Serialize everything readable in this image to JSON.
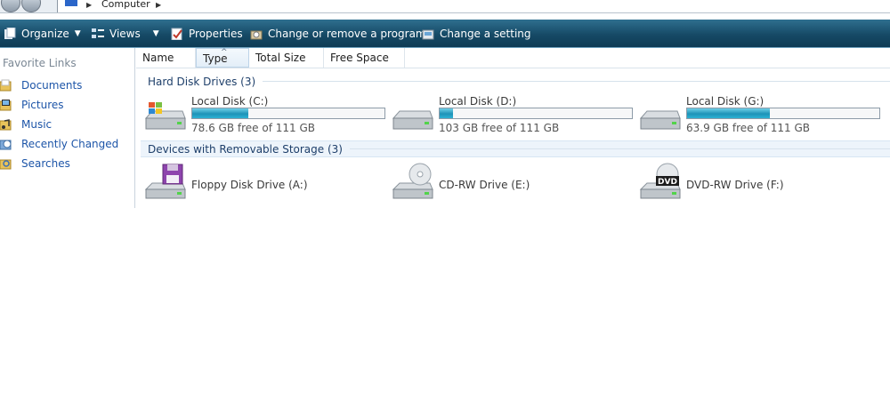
{
  "address": {
    "location": "Computer"
  },
  "toolbar": {
    "organize": "Organize",
    "views": "Views",
    "properties": "Properties",
    "change_remove": "Change or remove a program",
    "change_setting": "Change a setting"
  },
  "sidebar": {
    "title": "Favorite Links",
    "items": [
      {
        "label": "Documents",
        "icon": "documents-icon"
      },
      {
        "label": "Pictures",
        "icon": "pictures-icon"
      },
      {
        "label": "Music",
        "icon": "music-icon"
      },
      {
        "label": "Recently Changed",
        "icon": "recently-changed-icon"
      },
      {
        "label": "Searches",
        "icon": "searches-icon"
      }
    ]
  },
  "columns": [
    "Name",
    "Type",
    "Total Size",
    "Free Space"
  ],
  "groups": {
    "hard_disks": "Hard Disk Drives (3)",
    "removable": "Devices with Removable Storage (3)"
  },
  "drives": [
    {
      "name": "Local Disk (C:)",
      "free": "78.6 GB free of 111 GB",
      "used_fraction": 0.29
    },
    {
      "name": "Local Disk (D:)",
      "free": "103 GB free of 111 GB",
      "used_fraction": 0.07
    },
    {
      "name": "Local Disk (G:)",
      "free": "63.9 GB free of 111 GB",
      "used_fraction": 0.43
    }
  ],
  "removable": [
    {
      "name": "Floppy Disk Drive (A:)",
      "icon": "floppy-drive-icon"
    },
    {
      "name": "CD-RW Drive (E:)",
      "icon": "cd-drive-icon",
      "disc_label": ""
    },
    {
      "name": "DVD-RW Drive (F:)",
      "icon": "dvd-drive-icon",
      "disc_label": "DVD"
    }
  ],
  "colors": {
    "toolbar": "#164a66",
    "link": "#1d55a8",
    "bar_fill": "#1e93b8"
  }
}
